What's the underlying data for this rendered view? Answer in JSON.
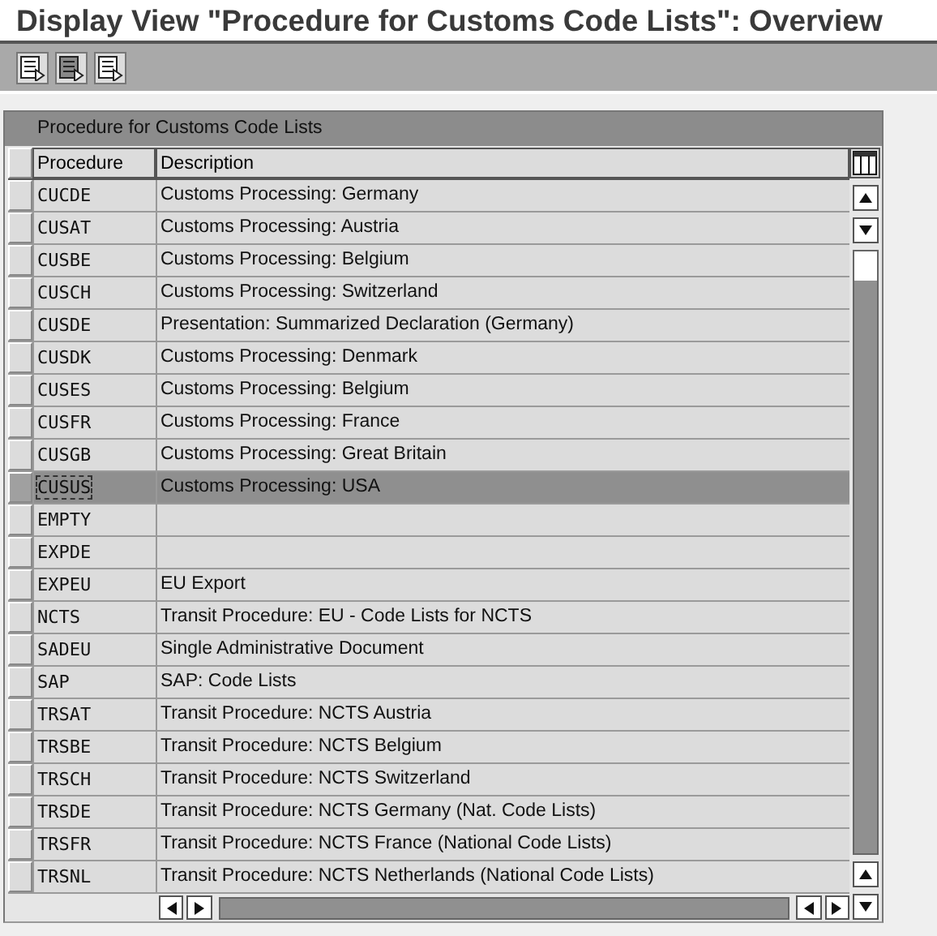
{
  "window": {
    "title": "Display View \"Procedure for Customs Code Lists\": Overview"
  },
  "table": {
    "caption": "Procedure for Customs Code Lists",
    "columns": [
      "Procedure",
      "Description"
    ],
    "rows": [
      {
        "procedure": "CUCDE",
        "description": "Customs Processing: Germany",
        "selected": false
      },
      {
        "procedure": "CUSAT",
        "description": "Customs Processing: Austria",
        "selected": false
      },
      {
        "procedure": "CUSBE",
        "description": "Customs Processing: Belgium",
        "selected": false
      },
      {
        "procedure": "CUSCH",
        "description": "Customs Processing: Switzerland",
        "selected": false
      },
      {
        "procedure": "CUSDE",
        "description": "Presentation: Summarized Declaration (Germany)",
        "selected": false
      },
      {
        "procedure": "CUSDK",
        "description": "Customs Processing: Denmark",
        "selected": false
      },
      {
        "procedure": "CUSES",
        "description": "Customs Processing: Belgium",
        "selected": false
      },
      {
        "procedure": "CUSFR",
        "description": "Customs Processing: France",
        "selected": false
      },
      {
        "procedure": "CUSGB",
        "description": "Customs Processing: Great Britain",
        "selected": false
      },
      {
        "procedure": "CUSUS",
        "description": "Customs Processing: USA",
        "selected": true
      },
      {
        "procedure": "EMPTY",
        "selected": false
      },
      {
        "procedure": "EXPDE",
        "selected": false
      },
      {
        "procedure": "EXPEU",
        "description": "EU Export",
        "selected": false
      },
      {
        "procedure": "NCTS",
        "description": "Transit Procedure: EU - Code Lists for NCTS",
        "selected": false
      },
      {
        "procedure": "SADEU",
        "description": "Single Administrative Document",
        "selected": false
      },
      {
        "procedure": "SAP",
        "description": "SAP: Code Lists",
        "selected": false
      },
      {
        "procedure": "TRSAT",
        "description": "Transit Procedure: NCTS Austria",
        "selected": false
      },
      {
        "procedure": "TRSBE",
        "description": "Transit Procedure: NCTS Belgium",
        "selected": false
      },
      {
        "procedure": "TRSCH",
        "description": "Transit Procedure: NCTS Switzerland",
        "selected": false
      },
      {
        "procedure": "TRSDE",
        "description": "Transit Procedure: NCTS Germany (Nat. Code Lists)",
        "selected": false
      },
      {
        "procedure": "TRSFR",
        "description": "Transit Procedure: NCTS France (National Code Lists)",
        "selected": false
      },
      {
        "procedure": "TRSNL",
        "description": "Transit Procedure: NCTS Netherlands (National Code Lists)",
        "selected": false
      }
    ]
  }
}
